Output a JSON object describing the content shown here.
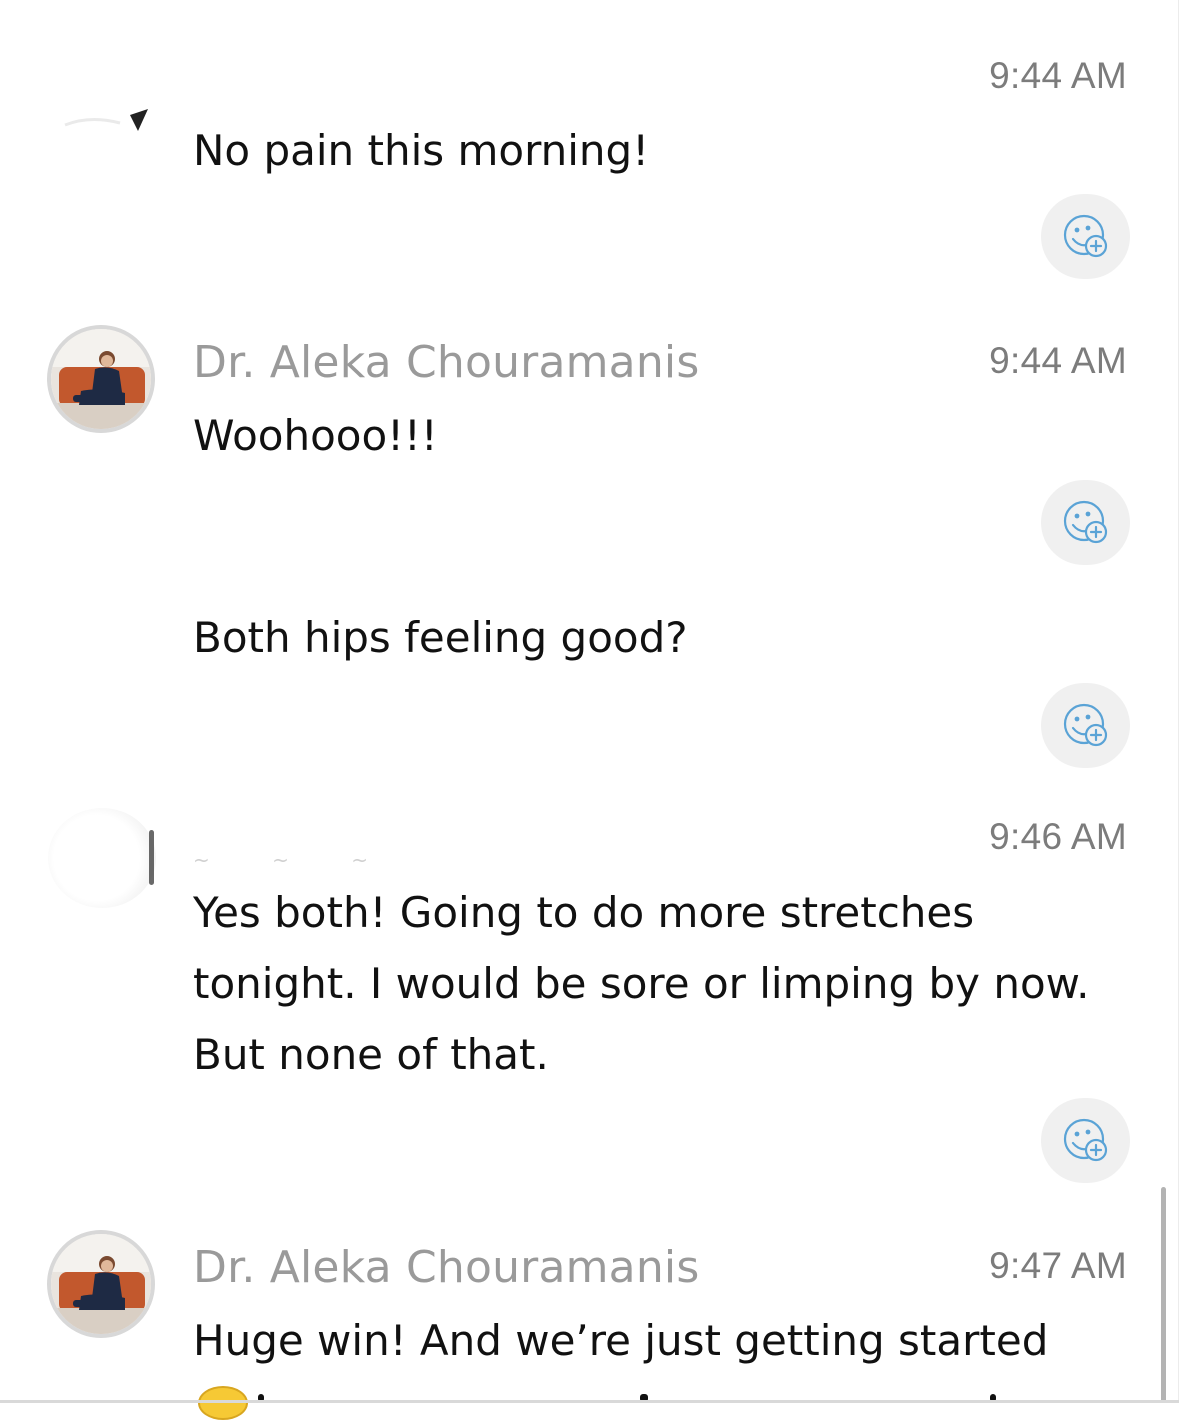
{
  "messages": [
    {
      "sender": "",
      "time": "9:44 AM",
      "lines": [
        "No pain this morning!"
      ]
    },
    {
      "sender": "Dr. Aleka Chouramanis",
      "time": "9:44 AM",
      "lines": [
        "Woohooo!!!"
      ]
    },
    {
      "sender": "",
      "time": "",
      "lines": [
        "Both hips feeling good?"
      ]
    },
    {
      "sender": "",
      "time": "9:46 AM",
      "lines": [
        "Yes both! Going to do more stretches",
        "tonight. I would be sore or limping by now.",
        "But none of that."
      ]
    },
    {
      "sender": "Dr. Aleka Chouramanis",
      "time": "9:47 AM",
      "lines": [
        "Huge win! And we’re just getting started"
      ]
    }
  ],
  "icons": {
    "reaction": "add-reaction-icon",
    "avatar": "avatar"
  },
  "colors": {
    "reaction_icon": "#5aa3d6",
    "reaction_bg": "#f0f0f0",
    "sender": "#9a9a9a",
    "time": "#7c7c7c",
    "text": "#111111"
  }
}
